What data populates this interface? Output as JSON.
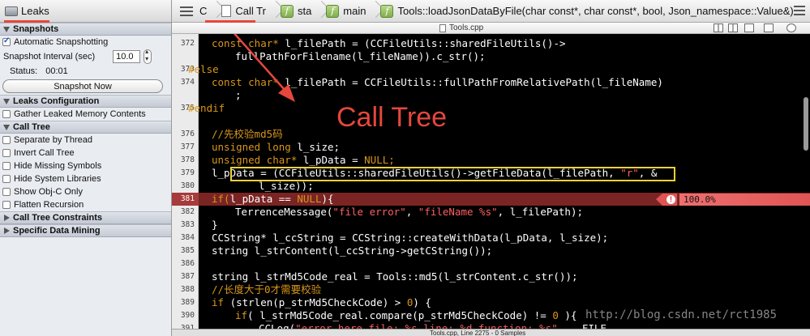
{
  "left_panel": {
    "title": "Leaks",
    "sections": {
      "snapshots": "Snapshots",
      "leaks_config": "Leaks Configuration",
      "call_tree": "Call Tree",
      "call_tree_constraints": "Call Tree Constraints",
      "specific_data_mining": "Specific Data Mining"
    },
    "automatic_snapshotting": "Automatic Snapshotting",
    "snapshot_interval_label": "Snapshot Interval (sec)",
    "snapshot_interval_value": "10.0",
    "status_label": "Status:",
    "status_value": "00:01",
    "snapshot_now": "Snapshot Now",
    "gather_leaked": "Gather Leaked Memory Contents",
    "call_tree_options": [
      "Separate by Thread",
      "Invert Call Tree",
      "Hide Missing Symbols",
      "Hide System Libraries",
      "Show Obj-C Only",
      "Flatten Recursion"
    ]
  },
  "breadcrumbs": {
    "partial": "С",
    "call_tree": "Call Tr",
    "sta": "sta",
    "main": "main",
    "func": "Tools::loadJsonDataByFile(char const*, char const*, bool, Json_namespace::Value&)"
  },
  "editor": {
    "filename": "Tools.cpp",
    "annotation": "Call Tree",
    "highlight_percent": "100.0%",
    "watermark": "http://blog.csdn.net/rct1985",
    "status": "Tools.cpp, Line 2275 - 0 Samples",
    "line_numbers": [
      "372",
      "",
      "373",
      "374",
      "",
      "375",
      "376",
      "377",
      "378",
      "379",
      "380",
      "",
      "381",
      "382",
      "383",
      "384",
      "385",
      "386",
      "387",
      "388",
      "389",
      "390",
      "391"
    ]
  },
  "code": {
    "l372a": "const char* ",
    "l372b": "l_filePath = (CCFileUtils::sharedFileUtils()->",
    "l372c": "fullPathForFilename(l_fileName)).c_str();",
    "l373": "#else",
    "l374a": "const char* ",
    "l374b": "l_filePath = CCFileUtils::fullPathFromRelativePath(l_fileName)",
    "l374c": ";",
    "l375": "#endif",
    "l377": "//先校验md5码",
    "l378a": "unsigned long ",
    "l378b": "l_size;",
    "l379a": "unsigned char* ",
    "l379b": "l_pData = ",
    "l379c": "NULL;",
    "l380a": "l_pData = (CCFileUtils::sharedFileUtils()->getFileData(l_filePath, ",
    "l380b": "\"r\"",
    "l380c": ", &",
    "l380d": "l_size));",
    "l381a": "if(",
    "l381b": "l_pData == ",
    "l381c": "NULL",
    "l381d": "){",
    "l382a": "TerrenceMessage(",
    "l382b": "\"file error\"",
    "l382c": ", ",
    "l382d": "\"fileName %s\"",
    "l382e": ", l_filePath);",
    "l383": "}",
    "l384": "CCString* l_ccString = CCString::createWithData(l_pData, l_size);",
    "l385": "string l_strContent(l_ccString->getCString());",
    "l387": "string l_strMd5Code_real = Tools::md5(l_strContent.c_str());",
    "l388": "//长度大于0才需要校验",
    "l389a": "if ",
    "l389b": "(strlen(p_strMd5CheckCode) > ",
    "l389c": "0",
    "l389d": ") {",
    "l390a": "if",
    "l390b": "( l_strMd5Code_real.compare(p_strMd5CheckCode) != ",
    "l390c": "0",
    "l390d": " ){",
    "l391a": "CCLog(",
    "l391b": "\"error here file: %s line: %d function: %s\"",
    "l391c": ", __FILE__"
  },
  "colors": {
    "accent_red": "#e5473c",
    "highlight_box": "#f0d23a",
    "keyword": "#d8961b",
    "string": "#ff5f5f"
  }
}
